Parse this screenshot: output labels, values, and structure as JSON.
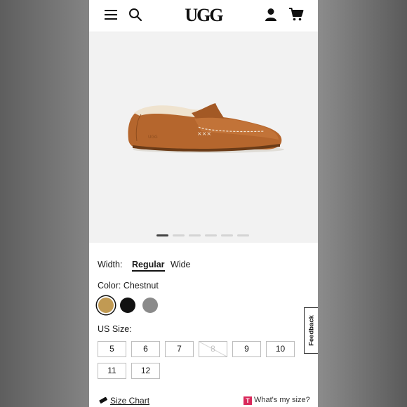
{
  "header": {
    "brand": "UGG",
    "menu_icon": "hamburger-icon",
    "search_icon": "search-icon",
    "account_icon": "user-icon",
    "cart_icon": "cart-icon"
  },
  "gallery": {
    "image_count": 6,
    "active_index": 0
  },
  "width": {
    "label": "Width:",
    "options": [
      "Regular",
      "Wide"
    ],
    "selected": "Regular"
  },
  "color": {
    "label": "Color: Chestnut",
    "swatches": [
      {
        "name": "Chestnut",
        "hex": "#c19a53",
        "selected": true
      },
      {
        "name": "Black",
        "hex": "#111111",
        "selected": false
      },
      {
        "name": "Grey",
        "hex": "#8a8a8a",
        "selected": false
      }
    ]
  },
  "size": {
    "label": "US Size:",
    "options": [
      "5",
      "6",
      "7",
      "8",
      "9",
      "10",
      "11",
      "12"
    ],
    "unavailable": [
      "8"
    ]
  },
  "links": {
    "size_chart": "Size Chart",
    "whats_my_size": "What's my size?",
    "whats_my_size_badge": "T"
  },
  "feedback": {
    "label": "Feedback"
  },
  "colors": {
    "accent": "#111111",
    "badge": "#d9295b"
  }
}
